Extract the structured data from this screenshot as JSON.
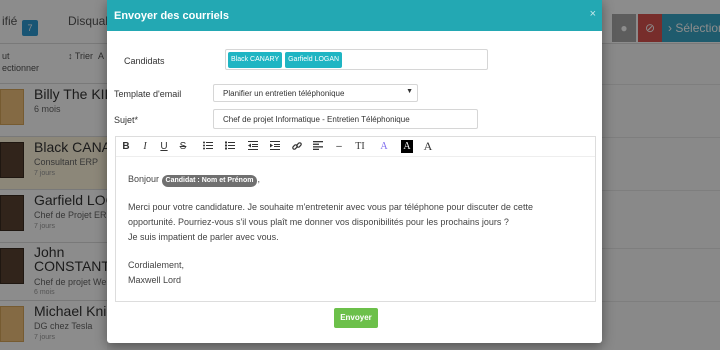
{
  "background": {
    "tabs": [
      {
        "label": "ifié"
      },
      {
        "label": "Disqualifié"
      }
    ],
    "count_badge": "7",
    "subbar": {
      "sort_label": "Trier",
      "partial_left_1": "ut",
      "partial_left_2": "ectionner",
      "partial_select": "A",
      "select_button": "Sélection"
    },
    "candidates": [
      {
        "name": "Billy The KID",
        "role": "",
        "time": "6 mois"
      },
      {
        "name": "Black CANARY",
        "role": "Consultant ERP",
        "time": "7 jours"
      },
      {
        "name": "Garfield LOGAN",
        "role": "Chef de Projet ERP",
        "time": "7 jours"
      },
      {
        "name": "John CONSTANTINE",
        "role": "Chef de projet Web",
        "time": "6 mois"
      },
      {
        "name": "Michael Knight",
        "role": "DG chez Tesla",
        "time": "7 jours"
      }
    ]
  },
  "modal": {
    "title": "Envoyer des courriels",
    "close_glyph": "×",
    "candidats_label": "Candidats",
    "recipients": [
      "Black CANARY",
      "Garfield LOGAN"
    ],
    "template_label": "Template d'email",
    "template_value": "Planifier un entretien téléphonique",
    "subject_label": "Sujet*",
    "subject_value": "Chef de projet Informatique - Entretien Téléphonique",
    "toolbar": {
      "bold": "B",
      "italic": "I",
      "underline": "U",
      "strike": "S",
      "heading": "TI",
      "font_color": "A",
      "bg_color": "A",
      "font_size": "A",
      "hr": "–"
    },
    "message": {
      "greeting": "Bonjour",
      "merge_tag": "Candidat : Nom et Prénom",
      "greeting_end": ",",
      "line1": "Merci pour votre candidature. Je souhaite m'entretenir avec vous par téléphone pour discuter de cette",
      "line2": "opportunité. Pourriez-vous s'il vous plaît me donner vos disponibilités pour les prochains jours ?",
      "line3": "Je suis impatient de parler avec vous.",
      "closing": "Cordialement,",
      "signature": "Maxwell Lord"
    },
    "send_label": "Envoyer"
  },
  "colors": {
    "header": "#23a8b3",
    "tag": "#1fb5c3",
    "send": "#6cc04a",
    "merge_tag": "#707070"
  }
}
